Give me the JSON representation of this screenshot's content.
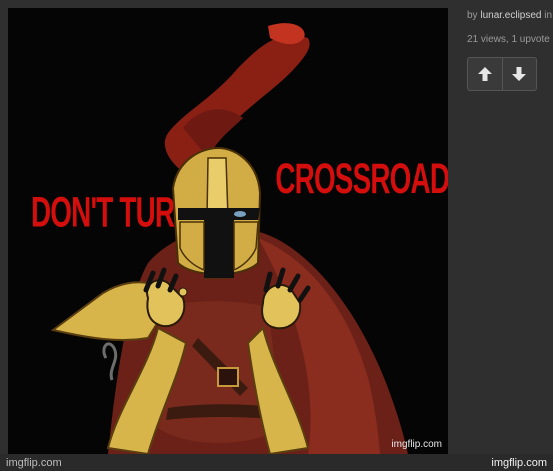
{
  "meme": {
    "caption_left": "DON'T TURN",
    "caption_right": "CROSSROADS",
    "inner_watermark": "imgflip.com",
    "caption_color": "#d40d0d"
  },
  "sidebar": {
    "by_label": "by",
    "author": "lunar.eclipsed",
    "author_suffix": " in",
    "stats": "21 views, 1 upvote",
    "upvote_icon": "arrow-up-icon",
    "downvote_icon": "arrow-down-icon"
  },
  "footer": {
    "watermark_left": "imgflip.com",
    "watermark_right": "imgflip.com"
  }
}
